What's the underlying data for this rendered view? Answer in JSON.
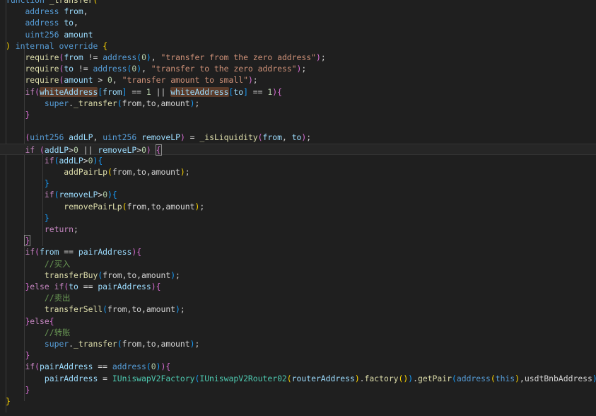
{
  "editor": {
    "background": "#1f1f1f",
    "lines": [
      {
        "indent": 0,
        "tokens": [
          {
            "t": "function",
            "c": "kw"
          },
          {
            "t": " "
          },
          {
            "t": "_transfer",
            "c": "fn"
          },
          {
            "t": "(",
            "c": "b1"
          }
        ]
      },
      {
        "indent": 1,
        "tokens": [
          {
            "t": "address",
            "c": "kw"
          },
          {
            "t": " "
          },
          {
            "t": "from",
            "c": "var"
          },
          {
            "t": ",",
            "c": "pl"
          }
        ]
      },
      {
        "indent": 1,
        "tokens": [
          {
            "t": "address",
            "c": "kw"
          },
          {
            "t": " "
          },
          {
            "t": "to",
            "c": "var"
          },
          {
            "t": ",",
            "c": "pl"
          }
        ]
      },
      {
        "indent": 1,
        "tokens": [
          {
            "t": "uint256",
            "c": "kw"
          },
          {
            "t": " "
          },
          {
            "t": "amount",
            "c": "var"
          }
        ]
      },
      {
        "indent": 0,
        "tokens": [
          {
            "t": ")",
            "c": "b1"
          },
          {
            "t": " "
          },
          {
            "t": "internal",
            "c": "kw"
          },
          {
            "t": " "
          },
          {
            "t": "override",
            "c": "kw"
          },
          {
            "t": " "
          },
          {
            "t": "{",
            "c": "b1"
          }
        ]
      },
      {
        "indent": 1,
        "tokens": [
          {
            "t": "require",
            "c": "fn"
          },
          {
            "t": "(",
            "c": "b2"
          },
          {
            "t": "from",
            "c": "var"
          },
          {
            "t": " != "
          },
          {
            "t": "address",
            "c": "kw"
          },
          {
            "t": "(",
            "c": "b3"
          },
          {
            "t": "0",
            "c": "num"
          },
          {
            "t": ")",
            "c": "b3"
          },
          {
            "t": ", "
          },
          {
            "t": "\"transfer from the zero address\"",
            "c": "str"
          },
          {
            "t": ")",
            "c": "b2"
          },
          {
            "t": ";"
          }
        ]
      },
      {
        "indent": 1,
        "tokens": [
          {
            "t": "require",
            "c": "fn"
          },
          {
            "t": "(",
            "c": "b2"
          },
          {
            "t": "to",
            "c": "var"
          },
          {
            "t": " != "
          },
          {
            "t": "address",
            "c": "kw"
          },
          {
            "t": "(",
            "c": "b3"
          },
          {
            "t": "0",
            "c": "num"
          },
          {
            "t": ")",
            "c": "b3"
          },
          {
            "t": ", "
          },
          {
            "t": "\"transfer to the zero address\"",
            "c": "str"
          },
          {
            "t": ")",
            "c": "b2"
          },
          {
            "t": ";"
          }
        ]
      },
      {
        "indent": 1,
        "tokens": [
          {
            "t": "require",
            "c": "fn"
          },
          {
            "t": "(",
            "c": "b2"
          },
          {
            "t": "amount",
            "c": "var"
          },
          {
            "t": " > "
          },
          {
            "t": "0",
            "c": "num"
          },
          {
            "t": ", "
          },
          {
            "t": "\"transfer amount to small\"",
            "c": "str"
          },
          {
            "t": ")",
            "c": "b2"
          },
          {
            "t": ";"
          }
        ]
      },
      {
        "indent": 1,
        "tokens": [
          {
            "t": "if",
            "c": "ctl"
          },
          {
            "t": "(",
            "c": "b2"
          },
          {
            "t": "whiteAddress",
            "c": "var",
            "hl": true
          },
          {
            "t": "[",
            "c": "b3"
          },
          {
            "t": "from",
            "c": "var"
          },
          {
            "t": "]",
            "c": "b3"
          },
          {
            "t": " == "
          },
          {
            "t": "1",
            "c": "num"
          },
          {
            "t": " || "
          },
          {
            "t": "whiteAddress",
            "c": "var",
            "hl": true
          },
          {
            "t": "[",
            "c": "b3"
          },
          {
            "t": "to",
            "c": "var"
          },
          {
            "t": "]",
            "c": "b3"
          },
          {
            "t": " == "
          },
          {
            "t": "1",
            "c": "num"
          },
          {
            "t": ")",
            "c": "b2"
          },
          {
            "t": "{",
            "c": "b2"
          }
        ]
      },
      {
        "indent": 2,
        "tokens": [
          {
            "t": "super",
            "c": "kw"
          },
          {
            "t": "."
          },
          {
            "t": "_transfer",
            "c": "fn"
          },
          {
            "t": "(",
            "c": "b3"
          },
          {
            "t": "from,to,amount"
          },
          {
            "t": ")",
            "c": "b3"
          },
          {
            "t": ";"
          }
        ]
      },
      {
        "indent": 1,
        "tokens": [
          {
            "t": "}",
            "c": "b2"
          }
        ]
      },
      {
        "indent": 0,
        "tokens": []
      },
      {
        "indent": 1,
        "tokens": [
          {
            "t": "(",
            "c": "b2"
          },
          {
            "t": "uint256",
            "c": "kw"
          },
          {
            "t": " "
          },
          {
            "t": "addLP",
            "c": "var"
          },
          {
            "t": ", "
          },
          {
            "t": "uint256",
            "c": "kw"
          },
          {
            "t": " "
          },
          {
            "t": "removeLP",
            "c": "var"
          },
          {
            "t": ")",
            "c": "b2"
          },
          {
            "t": " = "
          },
          {
            "t": "_isLiquidity",
            "c": "fn"
          },
          {
            "t": "(",
            "c": "b2"
          },
          {
            "t": "from",
            "c": "var"
          },
          {
            "t": ", "
          },
          {
            "t": "to",
            "c": "var"
          },
          {
            "t": ")",
            "c": "b2"
          },
          {
            "t": ";"
          }
        ]
      },
      {
        "indent": 1,
        "active": true,
        "tokens": [
          {
            "t": "if",
            "c": "ctl"
          },
          {
            "t": " "
          },
          {
            "t": "(",
            "c": "b2"
          },
          {
            "t": "addLP",
            "c": "var"
          },
          {
            "t": ">"
          },
          {
            "t": "0",
            "c": "num"
          },
          {
            "t": " || "
          },
          {
            "t": "removeLP",
            "c": "var"
          },
          {
            "t": ">"
          },
          {
            "t": "0",
            "c": "num"
          },
          {
            "t": ")",
            "c": "b2"
          },
          {
            "t": " "
          },
          {
            "t": "{",
            "c": "b2",
            "bm": true
          }
        ]
      },
      {
        "indent": 2,
        "tokens": [
          {
            "t": "if",
            "c": "ctl"
          },
          {
            "t": "(",
            "c": "b3"
          },
          {
            "t": "addLP",
            "c": "var"
          },
          {
            "t": ">"
          },
          {
            "t": "0",
            "c": "num"
          },
          {
            "t": ")",
            "c": "b3"
          },
          {
            "t": "{",
            "c": "b3"
          }
        ]
      },
      {
        "indent": 3,
        "tokens": [
          {
            "t": "addPairLp",
            "c": "fn"
          },
          {
            "t": "(",
            "c": "b1"
          },
          {
            "t": "from,to,amount"
          },
          {
            "t": ")",
            "c": "b1"
          },
          {
            "t": ";"
          }
        ]
      },
      {
        "indent": 2,
        "tokens": [
          {
            "t": "}",
            "c": "b3"
          }
        ]
      },
      {
        "indent": 2,
        "tokens": [
          {
            "t": "if",
            "c": "ctl"
          },
          {
            "t": "(",
            "c": "b3"
          },
          {
            "t": "removeLP",
            "c": "var"
          },
          {
            "t": ">"
          },
          {
            "t": "0",
            "c": "num"
          },
          {
            "t": ")",
            "c": "b3"
          },
          {
            "t": "{",
            "c": "b3"
          }
        ]
      },
      {
        "indent": 3,
        "tokens": [
          {
            "t": "removePairLp",
            "c": "fn"
          },
          {
            "t": "(",
            "c": "b1"
          },
          {
            "t": "from,to,amount"
          },
          {
            "t": ")",
            "c": "b1"
          },
          {
            "t": ";"
          }
        ]
      },
      {
        "indent": 2,
        "tokens": [
          {
            "t": "}",
            "c": "b3"
          }
        ]
      },
      {
        "indent": 2,
        "tokens": [
          {
            "t": "return",
            "c": "ctl"
          },
          {
            "t": ";"
          }
        ]
      },
      {
        "indent": 1,
        "tokens": [
          {
            "t": "}",
            "c": "b2",
            "bm": true
          }
        ]
      },
      {
        "indent": 1,
        "tokens": [
          {
            "t": "if",
            "c": "ctl"
          },
          {
            "t": "(",
            "c": "b2"
          },
          {
            "t": "from",
            "c": "var"
          },
          {
            "t": " == "
          },
          {
            "t": "pairAddress",
            "c": "var"
          },
          {
            "t": ")",
            "c": "b2"
          },
          {
            "t": "{",
            "c": "b2"
          }
        ]
      },
      {
        "indent": 2,
        "tokens": [
          {
            "t": "//买入",
            "c": "cm"
          }
        ]
      },
      {
        "indent": 2,
        "tokens": [
          {
            "t": "transferBuy",
            "c": "fn"
          },
          {
            "t": "(",
            "c": "b3"
          },
          {
            "t": "from,to,amount"
          },
          {
            "t": ")",
            "c": "b3"
          },
          {
            "t": ";"
          }
        ]
      },
      {
        "indent": 1,
        "tokens": [
          {
            "t": "}",
            "c": "b2"
          },
          {
            "t": "else if",
            "c": "ctl"
          },
          {
            "t": "(",
            "c": "b2"
          },
          {
            "t": "to",
            "c": "var"
          },
          {
            "t": " == "
          },
          {
            "t": "pairAddress",
            "c": "var"
          },
          {
            "t": ")",
            "c": "b2"
          },
          {
            "t": "{",
            "c": "b2"
          }
        ]
      },
      {
        "indent": 2,
        "tokens": [
          {
            "t": "//卖出",
            "c": "cm"
          }
        ]
      },
      {
        "indent": 2,
        "tokens": [
          {
            "t": "transferSell",
            "c": "fn"
          },
          {
            "t": "(",
            "c": "b3"
          },
          {
            "t": "from,to,amount"
          },
          {
            "t": ")",
            "c": "b3"
          },
          {
            "t": ";"
          }
        ]
      },
      {
        "indent": 1,
        "tokens": [
          {
            "t": "}",
            "c": "b2"
          },
          {
            "t": "else",
            "c": "ctl"
          },
          {
            "t": "{",
            "c": "b2"
          }
        ]
      },
      {
        "indent": 2,
        "tokens": [
          {
            "t": "//转账",
            "c": "cm"
          }
        ]
      },
      {
        "indent": 2,
        "tokens": [
          {
            "t": "super",
            "c": "kw"
          },
          {
            "t": "."
          },
          {
            "t": "_transfer",
            "c": "fn"
          },
          {
            "t": "(",
            "c": "b3"
          },
          {
            "t": "from,to,amount"
          },
          {
            "t": ")",
            "c": "b3"
          },
          {
            "t": ";"
          }
        ]
      },
      {
        "indent": 1,
        "tokens": [
          {
            "t": "}",
            "c": "b2"
          }
        ]
      },
      {
        "indent": 1,
        "tokens": [
          {
            "t": "if",
            "c": "ctl"
          },
          {
            "t": "(",
            "c": "b2"
          },
          {
            "t": "pairAddress",
            "c": "var"
          },
          {
            "t": " == "
          },
          {
            "t": "address",
            "c": "kw"
          },
          {
            "t": "(",
            "c": "b3"
          },
          {
            "t": "0",
            "c": "num"
          },
          {
            "t": ")",
            "c": "b3"
          },
          {
            "t": ")",
            "c": "b2"
          },
          {
            "t": "{",
            "c": "b2"
          }
        ]
      },
      {
        "indent": 2,
        "tokens": [
          {
            "t": "pairAddress",
            "c": "var"
          },
          {
            "t": " = "
          },
          {
            "t": "IUniswapV2Factory",
            "c": "ty"
          },
          {
            "t": "(",
            "c": "b3"
          },
          {
            "t": "IUniswapV2Router02",
            "c": "ty"
          },
          {
            "t": "(",
            "c": "b1"
          },
          {
            "t": "routerAddress",
            "c": "var"
          },
          {
            "t": ")",
            "c": "b1"
          },
          {
            "t": "."
          },
          {
            "t": "factory",
            "c": "fn"
          },
          {
            "t": "(",
            "c": "b1"
          },
          {
            "t": ")",
            "c": "b1"
          },
          {
            "t": ")",
            "c": "b3"
          },
          {
            "t": "."
          },
          {
            "t": "getPair",
            "c": "fn"
          },
          {
            "t": "(",
            "c": "b3"
          },
          {
            "t": "address",
            "c": "kw"
          },
          {
            "t": "(",
            "c": "b1"
          },
          {
            "t": "this",
            "c": "kw"
          },
          {
            "t": ")",
            "c": "b1"
          },
          {
            "t": ",usdtBnbAddress"
          },
          {
            "t": ")",
            "c": "b3"
          },
          {
            "t": ";"
          }
        ]
      },
      {
        "indent": 1,
        "tokens": [
          {
            "t": "}",
            "c": "b2"
          }
        ]
      },
      {
        "indent": 0,
        "tokens": [
          {
            "t": "}",
            "c": "b1"
          }
        ]
      }
    ]
  }
}
